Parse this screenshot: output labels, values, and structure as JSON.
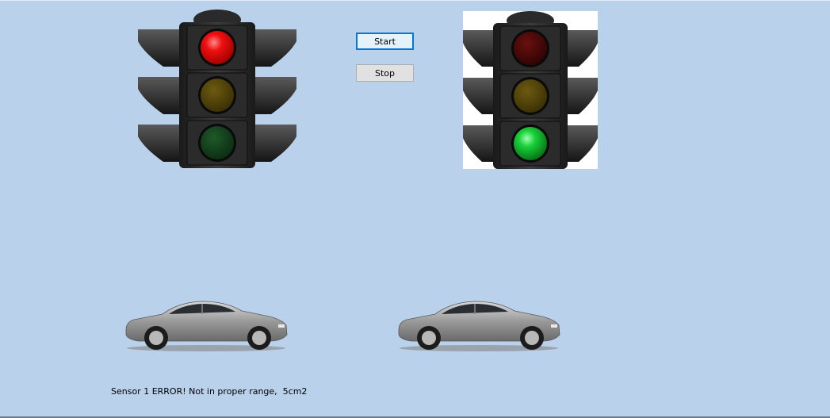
{
  "controls": {
    "start_label": "Start",
    "stop_label": "Stop"
  },
  "traffic_lights": [
    {
      "id": "light-1",
      "active": "red"
    },
    {
      "id": "light-2",
      "active": "green"
    }
  ],
  "status": {
    "message": "Sensor 1 ERROR! Not in proper range,  5cm2"
  }
}
